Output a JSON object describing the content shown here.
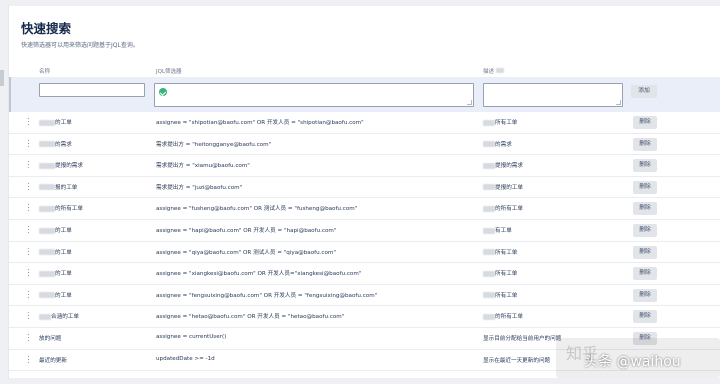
{
  "page": {
    "title": "快速搜索",
    "description": "快速筛选器可以用来筛选问题基于JQL查询。"
  },
  "columns": {
    "name": "名称",
    "jql": "JQL筛选器",
    "description": "描述"
  },
  "add_form": {
    "add_label": "添加"
  },
  "rows": [
    {
      "name": "的工单",
      "jql": "assignee = \"shipotian@baofu.com\" OR 开发人员 = \"shipotian@baofu.com\"",
      "desc": "所有工单",
      "delete_label": "删除"
    },
    {
      "name": "的需求",
      "jql": "需求提出方 = \"heitongganye@baofu.com\"",
      "desc": "的需求",
      "delete_label": "删除"
    },
    {
      "name": "提报的需求",
      "jql": "需求提出方 = \"xiamu@baofu.com\"",
      "desc": "提报的需求",
      "delete_label": "删除"
    },
    {
      "name": "报的工单",
      "jql": "需求提出方 = \"juzi@baofu.com\"",
      "desc": "提报的工单",
      "delete_label": "删除"
    },
    {
      "name": "的所有工单",
      "jql": "assignee = \"fusheng@baofu.com\" OR 测试人员 = \"fusheng@baofu.com\"",
      "desc": "的所有工单",
      "delete_label": "删除"
    },
    {
      "name": "的工单",
      "jql": "assignee = \"hapi@baofu.com\" OR 开发人员 = \"hapi@baofu.com\"",
      "desc": "有工单",
      "delete_label": "删除"
    },
    {
      "name": "的工单",
      "jql": "assignee = \"qiya@baofu.com\" OR 测试人员 = \"qiya@baofu.com\"",
      "desc": "所有工单",
      "delete_label": "删除"
    },
    {
      "name": "的工单",
      "jql": "assignee = \"xiangkesi@baofu.com\" OR 开发人员=\"xiangkesi@baofu.com\"",
      "desc": "所有工单",
      "delete_label": "删除"
    },
    {
      "name": "的工单",
      "jql": "assignee = \"fengsuixing@baofu.com\" OR 开发人员 = \"fengsuixing@baofu.com\"",
      "desc": "所有工单",
      "delete_label": "删除"
    },
    {
      "name": "合涵的工单",
      "jql": "assignee = \"hetao@baofu.com\" OR 开发人员 = \"hetao@baofu.com\"",
      "desc": "的所有工单",
      "delete_label": "删除"
    },
    {
      "name": "放的问题",
      "jql": "assignee = currentUser()",
      "desc": "显示目前分配给当前用户的问题",
      "delete_label": "删除"
    },
    {
      "name": "最近的更新",
      "jql": "updatedDate >= -1d",
      "desc": "显示在最近一天更新的问题",
      "delete_label": ""
    }
  ],
  "watermark": {
    "left_text": "知乎",
    "text": "头条 @waihou"
  }
}
